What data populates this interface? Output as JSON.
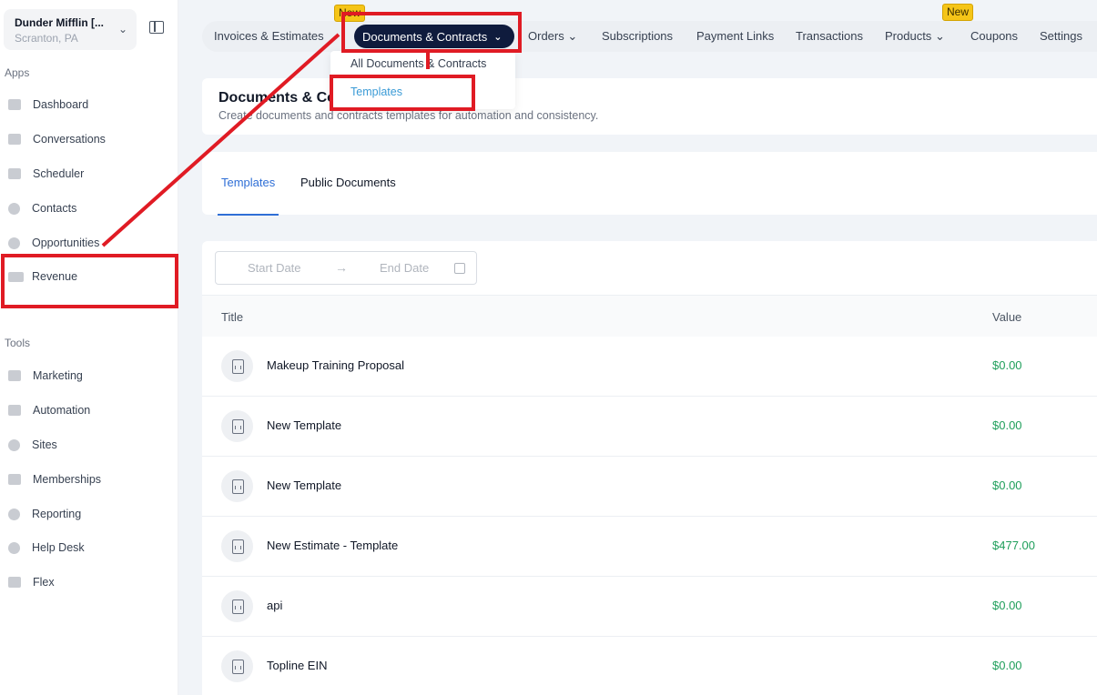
{
  "account": {
    "name": "Dunder Mifflin [...",
    "location": "Scranton, PA"
  },
  "sidebar": {
    "apps_label": "Apps",
    "apps": [
      {
        "label": "Dashboard",
        "icon": "dashboard-icon"
      },
      {
        "label": "Conversations",
        "icon": "chat-icon"
      },
      {
        "label": "Scheduler",
        "icon": "calendar-icon"
      },
      {
        "label": "Contacts",
        "icon": "person-icon"
      },
      {
        "label": "Opportunities",
        "icon": "target-icon"
      },
      {
        "label": "Revenue",
        "icon": "credit-card-icon"
      }
    ],
    "tools_label": "Tools",
    "tools": [
      {
        "label": "Marketing",
        "icon": "megaphone-icon"
      },
      {
        "label": "Automation",
        "icon": "gears-icon"
      },
      {
        "label": "Sites",
        "icon": "globe-icon"
      },
      {
        "label": "Memberships",
        "icon": "group-icon"
      },
      {
        "label": "Reporting",
        "icon": "pie-chart-icon"
      },
      {
        "label": "Help Desk",
        "icon": "help-icon"
      },
      {
        "label": "Flex",
        "icon": "people-icon"
      }
    ]
  },
  "topnav": {
    "tabs": {
      "invoices": "Invoices & Estimates",
      "documents": "Documents & Contracts",
      "orders": "Orders",
      "subscriptions": "Subscriptions",
      "payment_links": "Payment Links",
      "transactions": "Transactions",
      "products": "Products",
      "coupons": "Coupons",
      "settings": "Settings"
    },
    "badge_new": "New"
  },
  "dropdown": {
    "all": "All Documents & Contracts",
    "templates": "Templates"
  },
  "header": {
    "title": "Documents & Contracts",
    "subtitle": "Create documents and contracts templates for automation and consistency."
  },
  "subtabs": {
    "templates": "Templates",
    "public": "Public Documents"
  },
  "filters": {
    "start_date": "Start Date",
    "end_date": "End Date"
  },
  "table": {
    "col_title": "Title",
    "col_value": "Value",
    "rows": [
      {
        "title": "Makeup Training Proposal",
        "value": "$0.00"
      },
      {
        "title": "New Template",
        "value": "$0.00"
      },
      {
        "title": "New Template",
        "value": "$0.00"
      },
      {
        "title": "New Estimate - Template",
        "value": "$477.00"
      },
      {
        "title": "api",
        "value": "$0.00"
      },
      {
        "title": "Topline EIN",
        "value": "$0.00"
      }
    ]
  },
  "colors": {
    "accent": "#2f6fd6",
    "nav_active": "#0f1b3d",
    "value_green": "#1e9e5a",
    "annotation_red": "#e01b24",
    "badge": "#f5c518"
  }
}
